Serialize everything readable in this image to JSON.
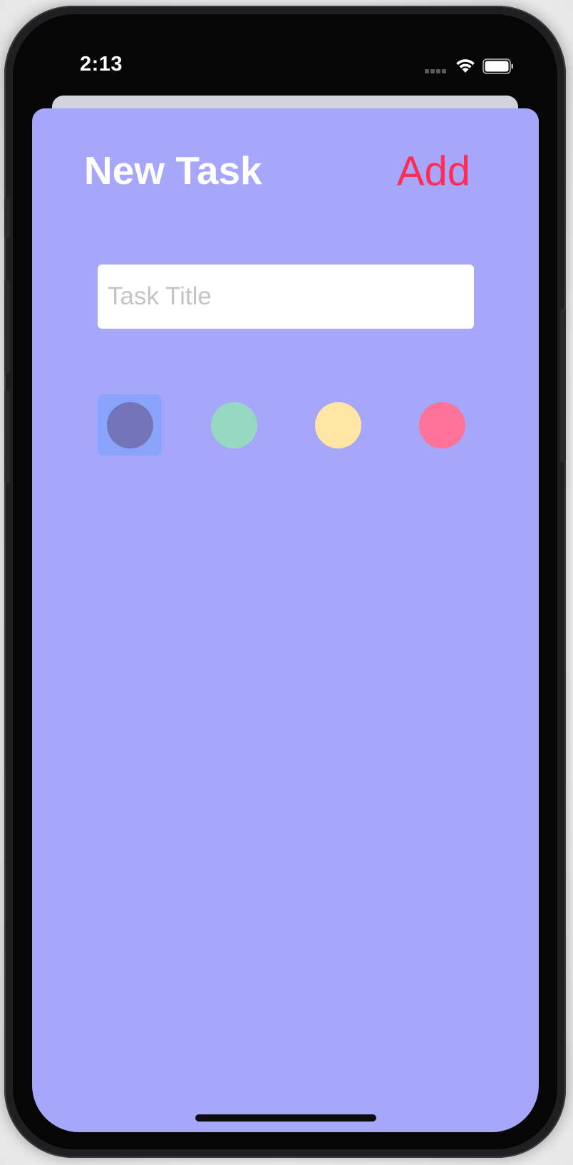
{
  "status_bar": {
    "time": "2:13",
    "wifi_icon": "wifi-icon",
    "battery_icon": "battery-icon",
    "cellular_icon": "cellular-dots-icon"
  },
  "sheet": {
    "title": "New Task",
    "add_label": "Add",
    "task_title_placeholder": "Task Title",
    "task_title_value": "",
    "colors": [
      {
        "name": "purple",
        "hex": "#7373b8",
        "selected": true
      },
      {
        "name": "green",
        "hex": "#96d9c2",
        "selected": false
      },
      {
        "name": "yellow",
        "hex": "#ffe6a3",
        "selected": false
      },
      {
        "name": "pink",
        "hex": "#ff7399",
        "selected": false
      }
    ],
    "background_color": "#a6a6fb",
    "accent_color": "#ff2d55",
    "selected_highlight_color": "#8aa4fb"
  }
}
